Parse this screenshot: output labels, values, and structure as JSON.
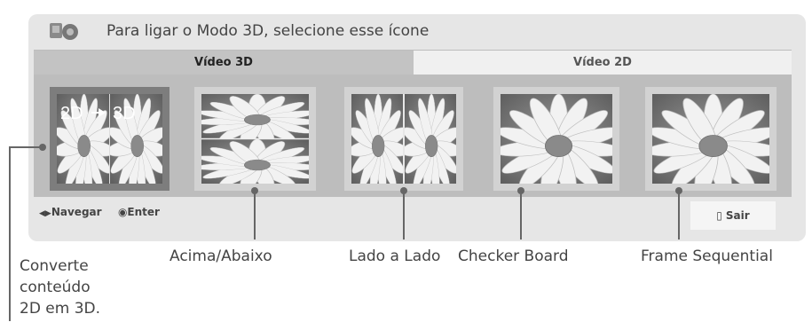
{
  "header": {
    "text": "Para ligar o Modo 3D, selecione esse ícone"
  },
  "tabs": {
    "video3d": "Vídeo 3D",
    "video2d": "Vídeo 2D"
  },
  "thumbnails": {
    "convert": {
      "left_text": "2D",
      "right_text": "3D"
    }
  },
  "footer": {
    "navigate": "Navegar",
    "enter": "Enter",
    "exit": "Sair"
  },
  "callouts": {
    "convert": [
      "Converte",
      "conteúdo",
      "2D em 3D."
    ],
    "top_bottom": "Acima/Abaixo",
    "side_by_side": "Lado a Lado",
    "checker_board": "Checker Board",
    "frame_sequential": "Frame Sequential"
  }
}
